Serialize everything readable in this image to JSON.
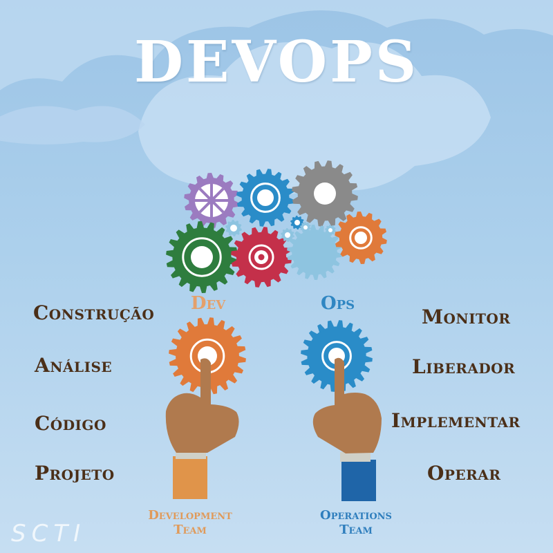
{
  "title": "DEVOPS",
  "center_labels": {
    "dev": "Dev",
    "ops": "Ops"
  },
  "left_items": [
    "Construção",
    "Análise",
    "Código",
    "Projeto"
  ],
  "right_items": [
    "Monitor",
    "Liberador",
    "Implementar",
    "Operar"
  ],
  "teams": {
    "development": [
      "Development",
      "Team"
    ],
    "operations": [
      "Operations",
      "Team"
    ]
  },
  "watermark": "SCTI",
  "colors": {
    "background": "#a9cdec",
    "label_brown": "#4b2f18",
    "dev_orange": "#e07a3a",
    "ops_blue": "#2a8cc8",
    "gear_purple": "#9b7bc0",
    "gear_blue": "#2a8cc8",
    "gear_gray": "#8a8a8a",
    "gear_green": "#2e7d3e",
    "gear_red": "#c4304a",
    "gear_lightblue": "#8ec4e0",
    "gear_orange": "#e07a3a"
  },
  "icons": [
    "gear-icon",
    "pointing-hand-icon",
    "cloud-shape"
  ]
}
